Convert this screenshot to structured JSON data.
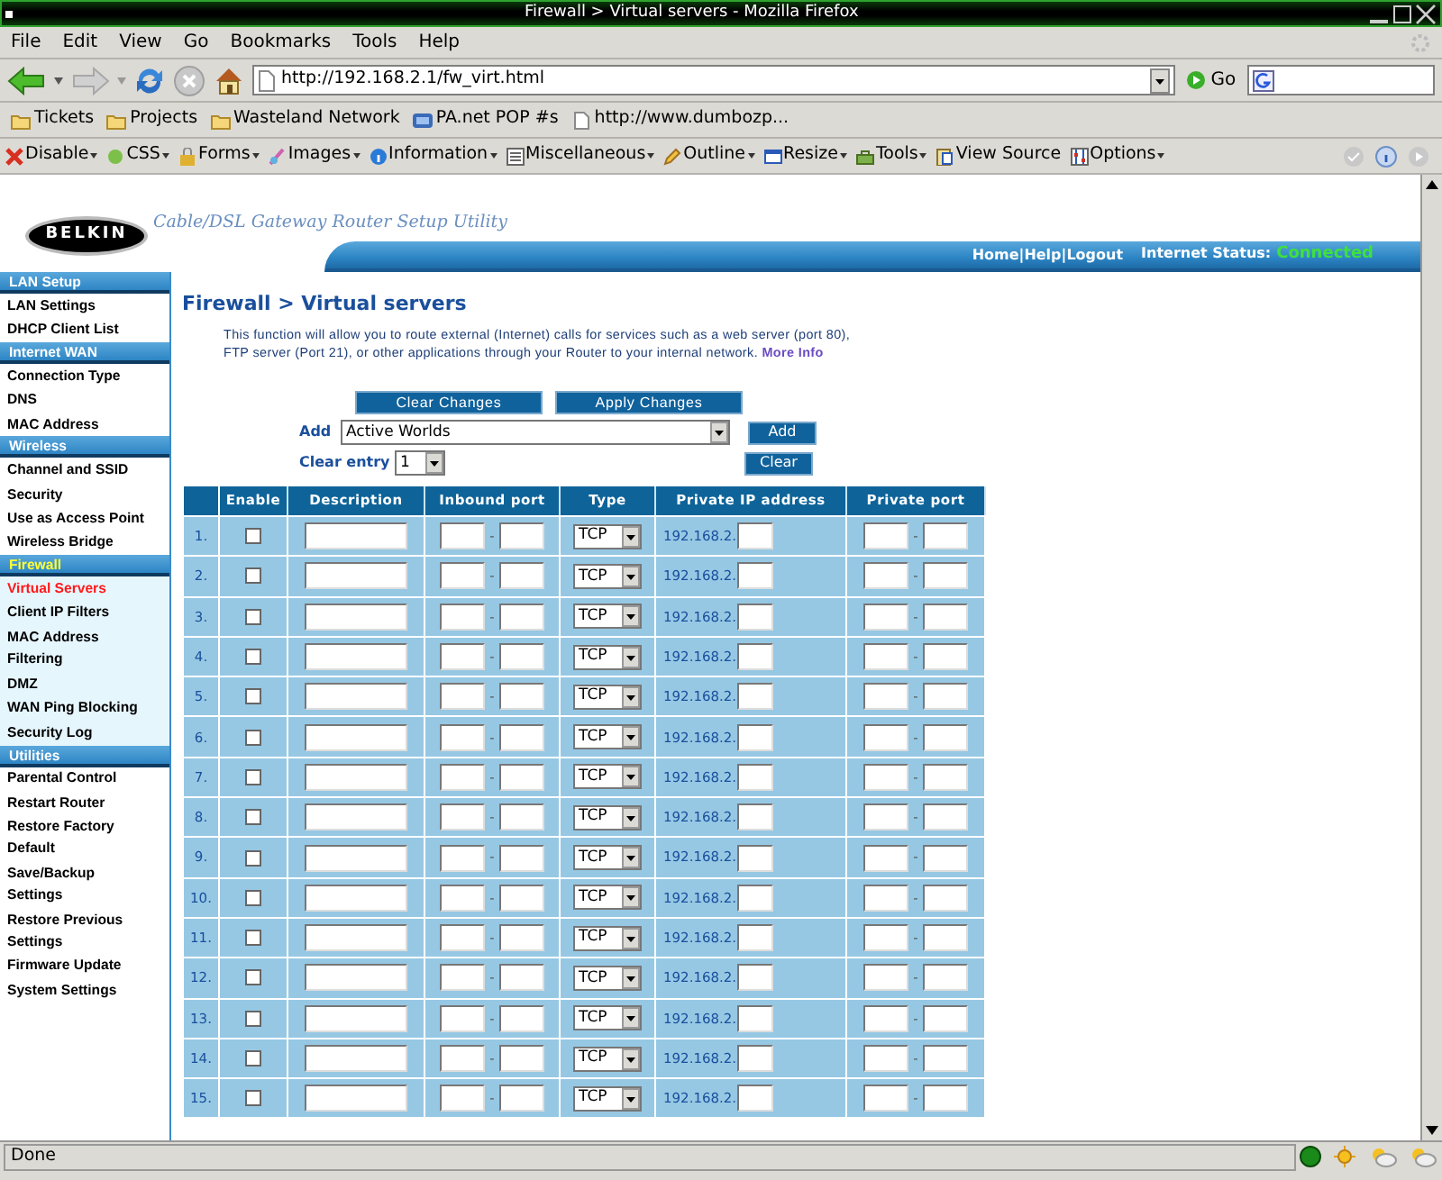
{
  "window": {
    "title": "Firewall > Virtual servers - Mozilla Firefox"
  },
  "menu": [
    "File",
    "Edit",
    "View",
    "Go",
    "Bookmarks",
    "Tools",
    "Help"
  ],
  "navigation": {
    "url": "http://192.168.2.1/fw_virt.html",
    "go": "Go"
  },
  "bookmarks": [
    {
      "label": "Tickets",
      "kind": "folder"
    },
    {
      "label": "Projects",
      "kind": "folder"
    },
    {
      "label": "Wasteland Network",
      "kind": "folder"
    },
    {
      "label": "PA.net POP #s",
      "kind": "site"
    },
    {
      "label": "http://www.dumbozp...",
      "kind": "page"
    }
  ],
  "dev_toolbar": [
    {
      "label": "Disable",
      "kind": "disable"
    },
    {
      "label": "CSS",
      "kind": "css"
    },
    {
      "label": "Forms",
      "kind": "forms"
    },
    {
      "label": "Images",
      "kind": "images"
    },
    {
      "label": "Information",
      "kind": "info"
    },
    {
      "label": "Miscellaneous",
      "kind": "misc"
    },
    {
      "label": "Outline",
      "kind": "outline"
    },
    {
      "label": "Resize",
      "kind": "resize"
    },
    {
      "label": "Tools",
      "kind": "tools"
    },
    {
      "label": "View Source",
      "kind": "source"
    },
    {
      "label": "Options",
      "kind": "options"
    }
  ],
  "page": {
    "logo": "BELKIN",
    "tagline": "Cable/DSL Gateway Router Setup Utility",
    "top_links": [
      "Home",
      "Help",
      "Logout"
    ],
    "link_separator": "|",
    "status_label": "Internet Status:",
    "status_value": "Connected",
    "sidebar": [
      {
        "title": "LAN Setup",
        "selected": false,
        "items": [
          {
            "label": "LAN Settings",
            "selected": false
          },
          {
            "label": "DHCP Client List",
            "selected": false
          }
        ]
      },
      {
        "title": "Internet WAN",
        "selected": false,
        "items": [
          {
            "label": "Connection Type",
            "selected": false
          },
          {
            "label": "DNS",
            "selected": false
          },
          {
            "label": "MAC Address",
            "selected": false
          }
        ]
      },
      {
        "title": "Wireless",
        "selected": false,
        "items": [
          {
            "label": "Channel and SSID",
            "selected": false
          },
          {
            "label": "Security",
            "selected": false
          },
          {
            "label": "Use as Access Point",
            "selected": false
          },
          {
            "label": "Wireless Bridge",
            "selected": false
          }
        ]
      },
      {
        "title": "Firewall",
        "selected": true,
        "items": [
          {
            "label": "Virtual Servers",
            "selected": true
          },
          {
            "label": "Client IP Filters",
            "selected": false
          },
          {
            "label": "MAC Address Filtering",
            "selected": false
          },
          {
            "label": "DMZ",
            "selected": false
          },
          {
            "label": "WAN Ping Blocking",
            "selected": false
          },
          {
            "label": "Security Log",
            "selected": false
          }
        ]
      },
      {
        "title": "Utilities",
        "selected": false,
        "items": [
          {
            "label": "Parental Control",
            "selected": false
          },
          {
            "label": "Restart Router",
            "selected": false
          },
          {
            "label": "Restore Factory Default",
            "selected": false
          },
          {
            "label": "Save/Backup Settings",
            "selected": false
          },
          {
            "label": "Restore Previous Settings",
            "selected": false
          },
          {
            "label": "Firmware Update",
            "selected": false
          },
          {
            "label": "System Settings",
            "selected": false
          }
        ]
      }
    ],
    "heading": "Firewall > Virtual servers",
    "description": "This function will allow you to route external (Internet) calls for services such as a web server (port 80), FTP server (Port 21), or other applications through your Router to your internal network.",
    "more_info": "More Info",
    "buttons": [
      "Clear Changes",
      "Apply Changes"
    ],
    "add_label": "Add",
    "add_value": "Active Worlds",
    "add_button": "Add",
    "clear_label": "Clear entry",
    "clear_value": "1",
    "clear_button": "Clear",
    "columns": [
      "Enable",
      "Description",
      "Inbound port",
      "Type",
      "Private IP address",
      "Private port"
    ],
    "port_separator": "-",
    "rows": [
      {
        "number": "1.",
        "enabled": false,
        "type": "TCP",
        "ip_prefix": "192.168.2."
      },
      {
        "number": "2.",
        "enabled": false,
        "type": "TCP",
        "ip_prefix": "192.168.2."
      },
      {
        "number": "3.",
        "enabled": false,
        "type": "TCP",
        "ip_prefix": "192.168.2."
      },
      {
        "number": "4.",
        "enabled": false,
        "type": "TCP",
        "ip_prefix": "192.168.2."
      },
      {
        "number": "5.",
        "enabled": false,
        "type": "TCP",
        "ip_prefix": "192.168.2."
      },
      {
        "number": "6.",
        "enabled": false,
        "type": "TCP",
        "ip_prefix": "192.168.2."
      },
      {
        "number": "7.",
        "enabled": false,
        "type": "TCP",
        "ip_prefix": "192.168.2."
      },
      {
        "number": "8.",
        "enabled": false,
        "type": "TCP",
        "ip_prefix": "192.168.2."
      },
      {
        "number": "9.",
        "enabled": false,
        "type": "TCP",
        "ip_prefix": "192.168.2."
      },
      {
        "number": "10.",
        "enabled": false,
        "type": "TCP",
        "ip_prefix": "192.168.2."
      },
      {
        "number": "11.",
        "enabled": false,
        "type": "TCP",
        "ip_prefix": "192.168.2."
      },
      {
        "number": "12.",
        "enabled": false,
        "type": "TCP",
        "ip_prefix": "192.168.2."
      },
      {
        "number": "13.",
        "enabled": false,
        "type": "TCP",
        "ip_prefix": "192.168.2."
      },
      {
        "number": "14.",
        "enabled": false,
        "type": "TCP",
        "ip_prefix": "192.168.2."
      },
      {
        "number": "15.",
        "enabled": false,
        "type": "TCP",
        "ip_prefix": "192.168.2."
      }
    ]
  },
  "status_bar": {
    "text": "Done"
  }
}
